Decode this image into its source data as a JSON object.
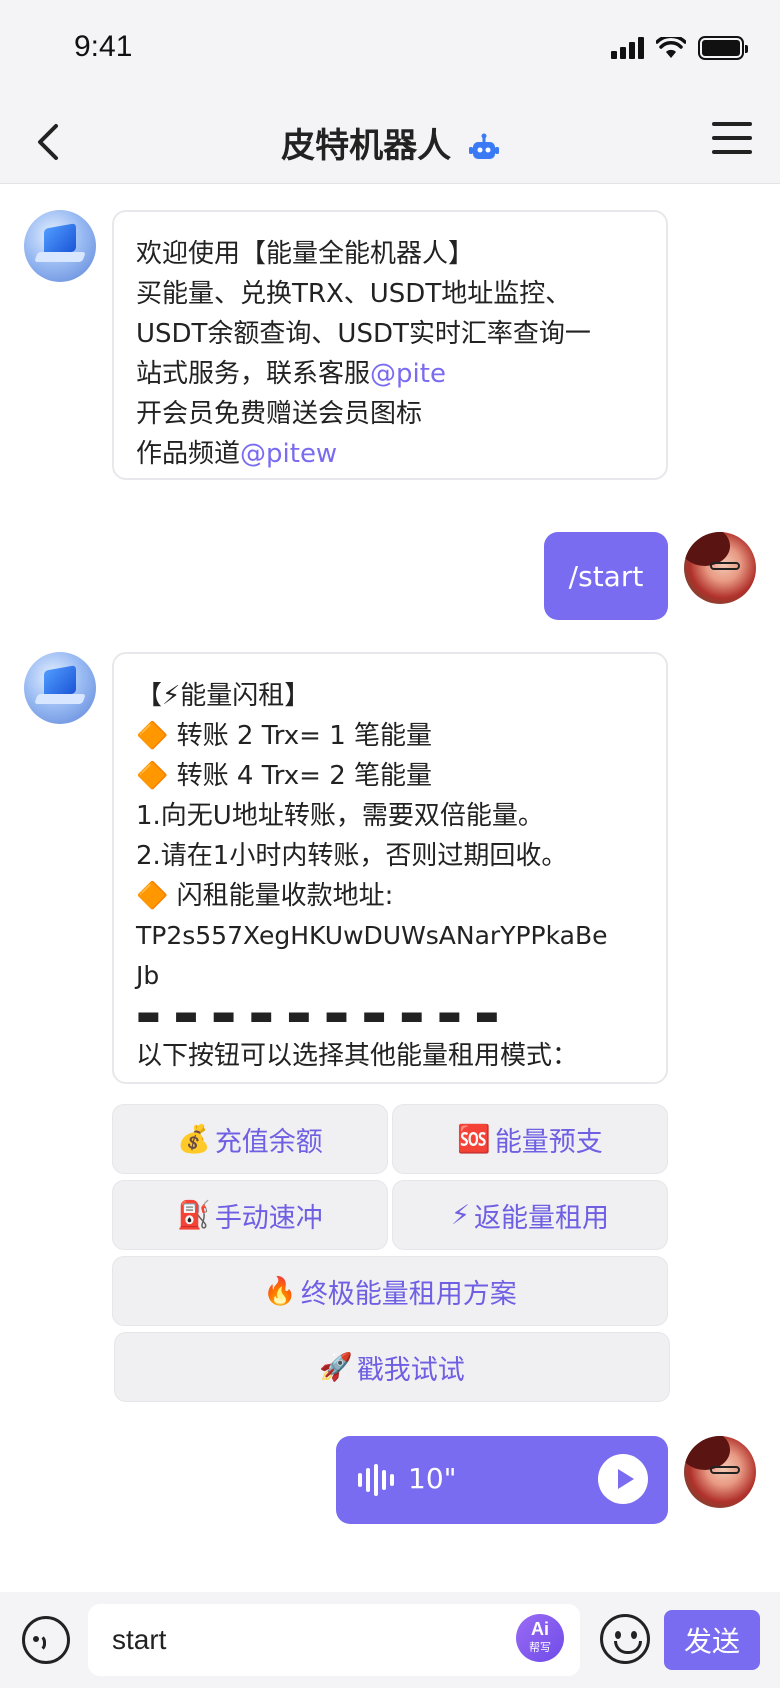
{
  "status_bar": {
    "time": "9:41"
  },
  "header": {
    "title": "皮特机器人",
    "bot_icon": "robot-icon"
  },
  "messages": {
    "welcome": {
      "lines": [
        "欢迎使用【能量全能机器人】",
        "买能量、兑换TRX、USDT地址监控、",
        "USDT余额查询、USDT实时汇率查询一",
        "站式服务，联系客服"
      ],
      "mention_service": "@pite",
      "line5": "开会员免费赠送会员图标",
      "line6": "作品频道",
      "mention_channel": "@pitew"
    },
    "user_command": "/start",
    "energy": {
      "title": "【⚡能量闪租】",
      "diamond": "🔶",
      "rate1": "转账  2 Trx=  1 笔能量",
      "rate2": "转账  4 Trx=  2 笔能量",
      "note1": "1.向无U地址转账，需要双倍能量。",
      "note2": "2.请在1小时内转账，否则过期回收。",
      "address_label": "闪租能量收款地址:",
      "address_part1": "TP2s557XegHKUwDUWsANarYPPkaBe",
      "address_part2": "Jb",
      "divider": "▬ ▬ ▬ ▬ ▬ ▬ ▬ ▬ ▬ ▬",
      "footer": "以下按钮可以选择其他能量租用模式："
    },
    "voice": {
      "duration": "10\""
    }
  },
  "keyboard": {
    "recharge": {
      "emoji": "💰",
      "label": "充值余额"
    },
    "advance": {
      "emoji": "🆘",
      "label": "能量预支"
    },
    "manual": {
      "emoji": "⛽",
      "label": "手动速冲"
    },
    "return_rent": {
      "emoji": "⚡",
      "label": "返能量租用"
    },
    "ultimate": {
      "emoji": "🔥",
      "label": "终极能量租用方案"
    },
    "try": {
      "emoji": "🚀",
      "label": "戳我试试"
    }
  },
  "input": {
    "value": "start",
    "ai_main": "Ai",
    "ai_sub": "帮写",
    "send_label": "发送"
  },
  "colors": {
    "accent": "#7a6cf0",
    "bg": "#f4f4f6"
  }
}
